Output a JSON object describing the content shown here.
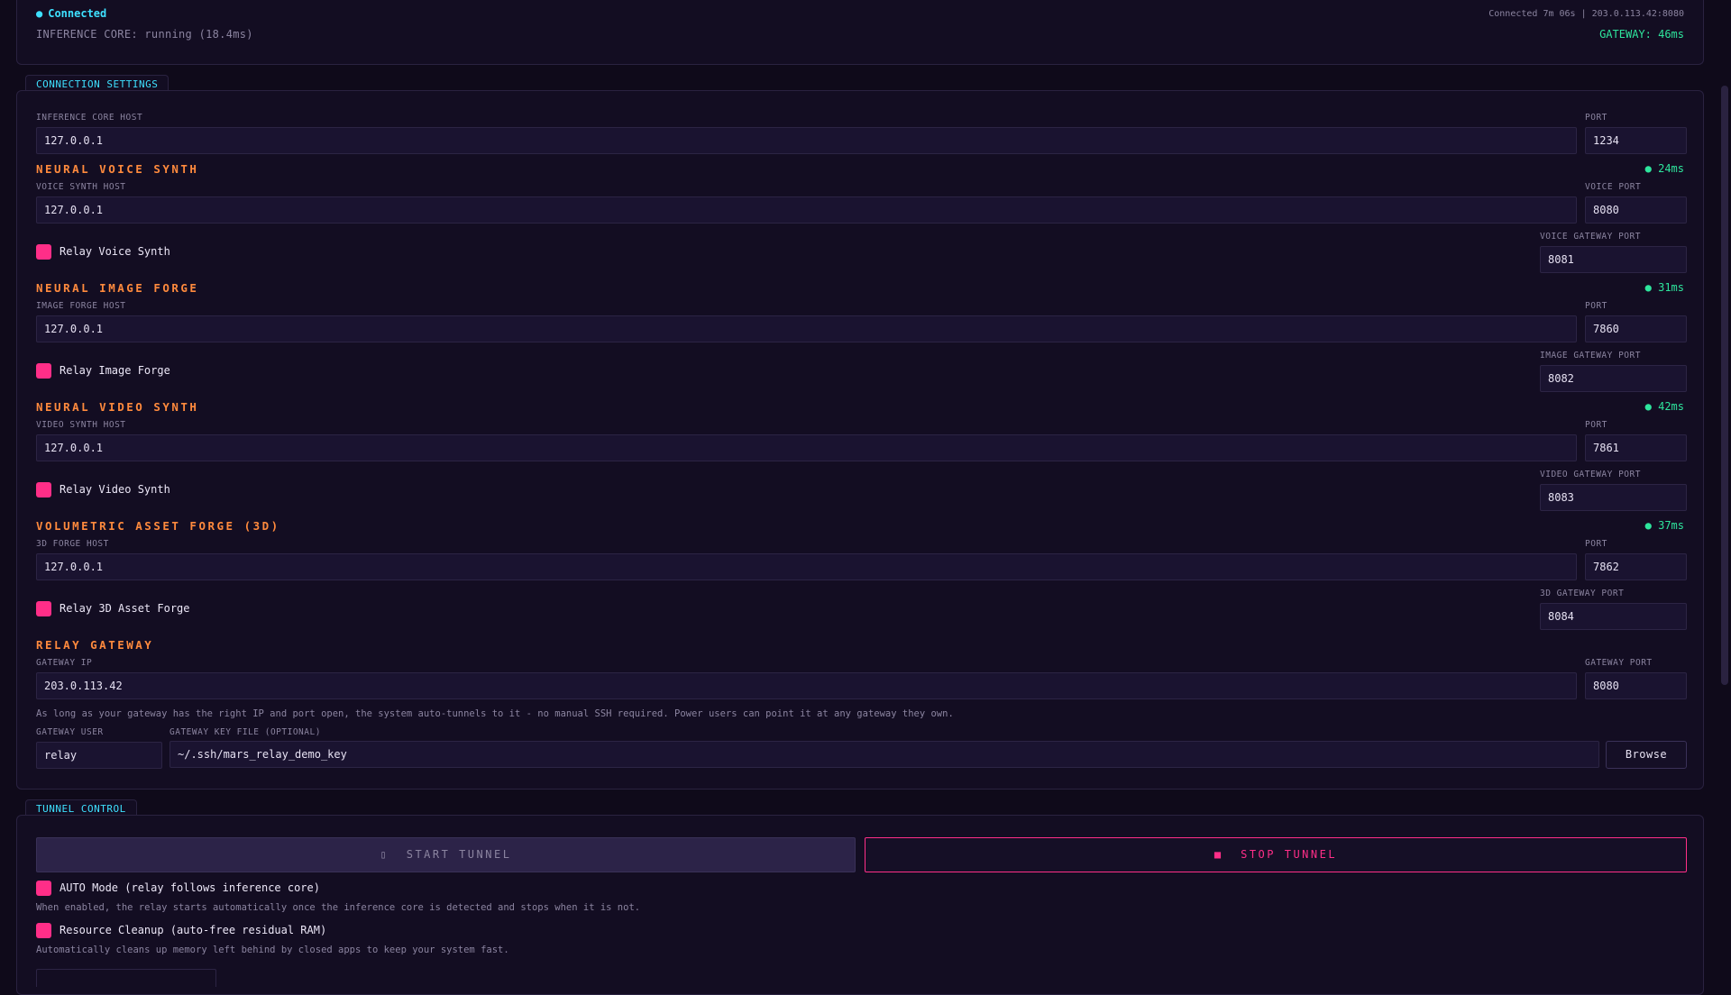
{
  "status": {
    "connection": "Connected",
    "inference_core": "INFERENCE CORE: running (18.4ms)",
    "session": "Connected 7m 06s | 203.0.113.42:8080",
    "gateway_latency": "GATEWAY: 46ms"
  },
  "colors": {
    "accent_cyan": "#3ee0ff",
    "accent_orange": "#ff8a3d",
    "accent_pink": "#ff2e88",
    "ok_green": "#2ee59d"
  },
  "connection_settings": {
    "title": "CONNECTION SETTINGS",
    "inference_host_label": "INFERENCE CORE HOST",
    "inference_host": "127.0.0.1",
    "inference_port_label": "PORT",
    "inference_port": "1234",
    "voice": {
      "title": "NEURAL VOICE SYNTH",
      "latency": "● 24ms",
      "host_label": "VOICE SYNTH HOST",
      "host": "127.0.0.1",
      "port_label": "VOICE PORT",
      "port": "8080",
      "relay_label": "Relay Voice Synth",
      "relay_checked": true,
      "gateway_port_label": "VOICE GATEWAY PORT",
      "gateway_port": "8081"
    },
    "image": {
      "title": "NEURAL IMAGE FORGE",
      "latency": "● 31ms",
      "host_label": "IMAGE FORGE HOST",
      "host": "127.0.0.1",
      "port_label": "PORT",
      "port": "7860",
      "relay_label": "Relay Image Forge",
      "relay_checked": true,
      "gateway_port_label": "IMAGE GATEWAY PORT",
      "gateway_port": "8082"
    },
    "video": {
      "title": "NEURAL VIDEO SYNTH",
      "latency": "● 42ms",
      "host_label": "VIDEO SYNTH HOST",
      "host": "127.0.0.1",
      "port_label": "PORT",
      "port": "7861",
      "relay_label": "Relay Video Synth",
      "relay_checked": true,
      "gateway_port_label": "VIDEO GATEWAY PORT",
      "gateway_port": "8083"
    },
    "asset3d": {
      "title": "VOLUMETRIC ASSET FORGE (3D)",
      "latency": "● 37ms",
      "host_label": "3D FORGE HOST",
      "host": "127.0.0.1",
      "port_label": "PORT",
      "port": "7862",
      "relay_label": "Relay 3D Asset Forge",
      "relay_checked": true,
      "gateway_port_label": "3D GATEWAY PORT",
      "gateway_port": "8084"
    },
    "gateway": {
      "title": "RELAY GATEWAY",
      "ip_label": "GATEWAY IP",
      "ip": "203.0.113.42",
      "port_label": "GATEWAY PORT",
      "port": "8080",
      "help": "As long as your gateway has the right IP and port open, the system auto-tunnels to it - no manual SSH required. Power users can point it at any gateway they own.",
      "user_label": "GATEWAY USER",
      "user": "relay",
      "key_label": "GATEWAY KEY FILE (OPTIONAL)",
      "key": "~/.ssh/mars_relay_demo_key",
      "browse_label": "Browse"
    }
  },
  "tunnel_control": {
    "title": "TUNNEL CONTROL",
    "start_label": "START TUNNEL",
    "stop_label": "STOP TUNNEL",
    "auto_mode_label": "AUTO Mode (relay follows inference core)",
    "auto_mode_checked": true,
    "auto_mode_help": "When enabled, the relay starts automatically once the inference core is detected and stops when it is not.",
    "cleanup_label": "Resource Cleanup (auto-free residual RAM)",
    "cleanup_checked": true,
    "cleanup_help": "Automatically cleans up memory left behind by closed apps to keep your system fast."
  }
}
